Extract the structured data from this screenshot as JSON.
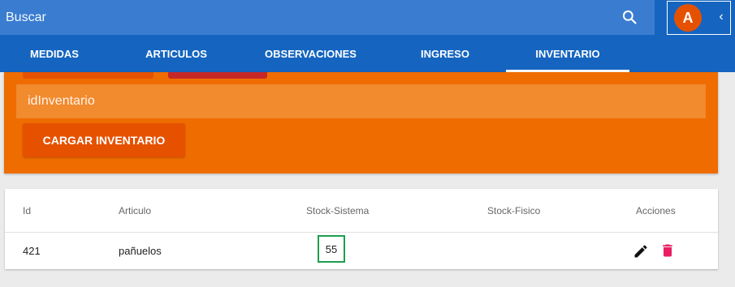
{
  "search": {
    "placeholder": "Buscar"
  },
  "user": {
    "avatar_initial": "A"
  },
  "tabs": [
    {
      "label": "MEDIDAS"
    },
    {
      "label": "ARTICULOS"
    },
    {
      "label": "OBSERVACIONES"
    },
    {
      "label": "INGRESO"
    },
    {
      "label": "INVENTARIO",
      "active": true
    }
  ],
  "inventory_form": {
    "id_placeholder": "idInventario",
    "load_button": "CARGAR INVENTARIO"
  },
  "table": {
    "headers": [
      "Id",
      "Articulo",
      "Stock-Sistema",
      "Stock-Fisico",
      "Acciones"
    ],
    "rows": [
      {
        "id": "421",
        "articulo": "pañuelos",
        "stock_sistema": "55",
        "stock_fisico": ""
      }
    ]
  },
  "colors": {
    "primary": "#1565c0",
    "accent_orange": "#ef6c00",
    "button_orange": "#e65100",
    "delete": "#e91e63",
    "stock_highlight": "#1e9e4f"
  }
}
